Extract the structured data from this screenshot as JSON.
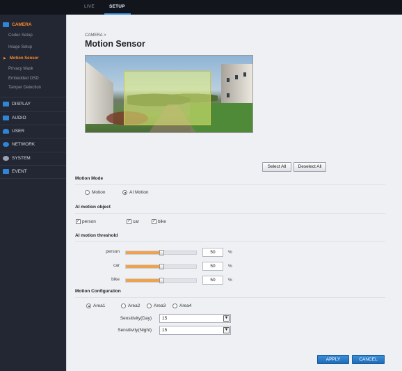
{
  "topbar": {
    "tabs": [
      "LIVE",
      "SETUP"
    ]
  },
  "sidebar": {
    "sections": [
      {
        "label": "CAMERA",
        "active": true,
        "color": "#2f86d6"
      },
      {
        "label": "DISPLAY",
        "color": "#2f86d6"
      },
      {
        "label": "AUDIO",
        "color": "#2f86d6"
      },
      {
        "label": "USER",
        "color": "#2f86d6"
      },
      {
        "label": "NETWORK",
        "color": "#2f86d6"
      },
      {
        "label": "SYSTEM",
        "color": "#9aa3b5"
      },
      {
        "label": "EVENT",
        "color": "#2f86d6"
      }
    ],
    "camera_items": [
      "Codec Setup",
      "Image Setup",
      "Motion Sensor",
      "Privacy Mask",
      "Embedded OSD",
      "Tamper Detection"
    ],
    "active_item": "Motion Sensor",
    "accent": "#ff8a2a"
  },
  "header": {
    "breadcrumb": "CAMERA >",
    "title": "Motion Sensor"
  },
  "area_buttons": {
    "select_all": "Select All",
    "deselect_all": "Deselect All"
  },
  "motion_mode": {
    "title": "Motion Mode",
    "options": [
      "Motion",
      "AI Motion"
    ],
    "selected": "AI Motion"
  },
  "ai_object": {
    "title": "AI motion object",
    "items": [
      {
        "label": "person",
        "checked": true
      },
      {
        "label": "car",
        "checked": true
      },
      {
        "label": "bike",
        "checked": true
      }
    ]
  },
  "ai_threshold": {
    "title": "AI motion threshold",
    "unit": "%",
    "rows": [
      {
        "label": "person",
        "value": "50"
      },
      {
        "label": "car",
        "value": "50"
      },
      {
        "label": "bike",
        "value": "50"
      }
    ]
  },
  "configuration": {
    "title": "Motion Configuration",
    "areas": [
      "Area1",
      "Area2",
      "Area3",
      "Area4"
    ],
    "selected_area": "Area1",
    "sensitivity_day_label": "Sensitivity(Day)",
    "sensitivity_day_value": "15",
    "sensitivity_night_label": "Sensitivity(Night)",
    "sensitivity_night_value": "15"
  },
  "footer": {
    "apply": "APPLY",
    "cancel": "CANCEL"
  }
}
